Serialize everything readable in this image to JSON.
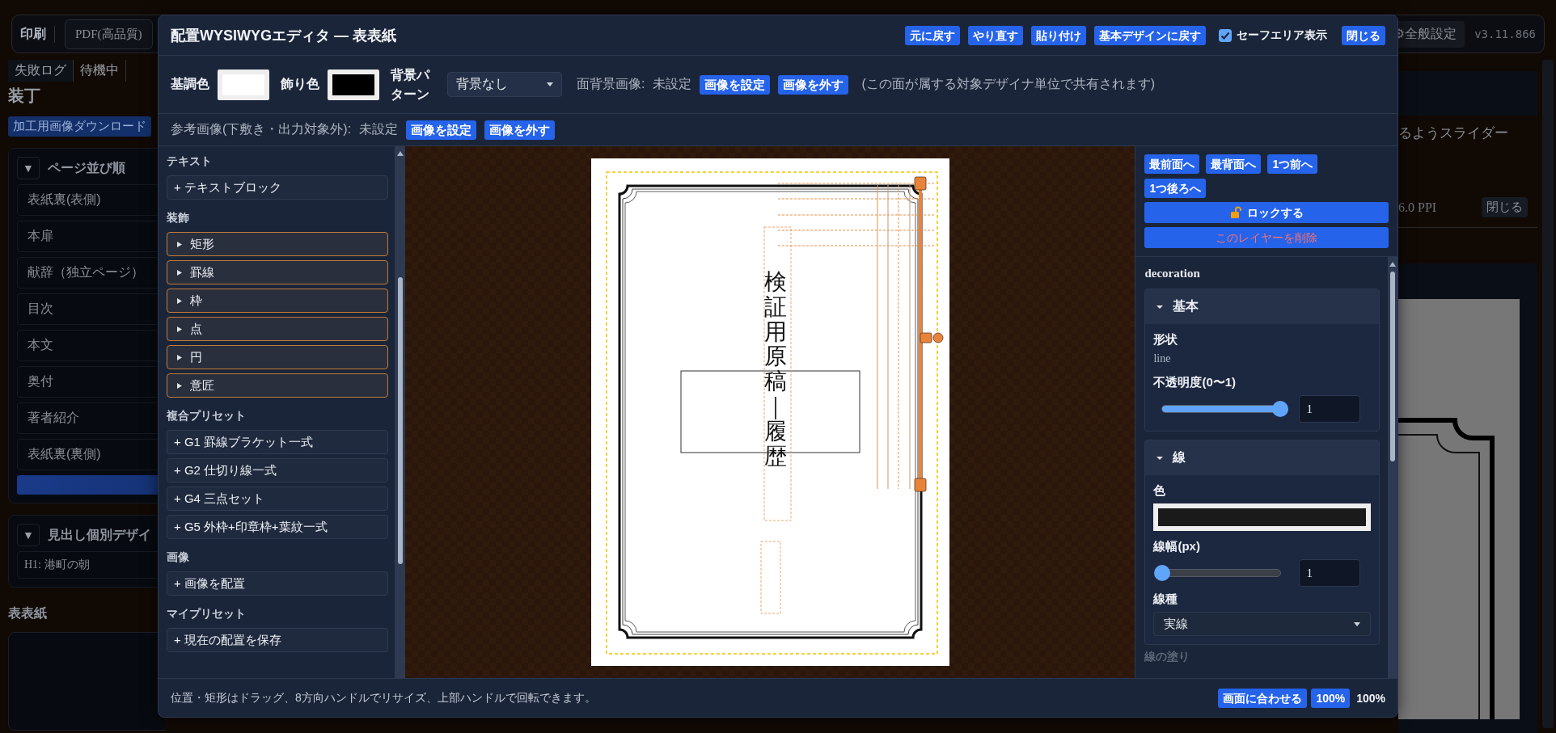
{
  "background_app": {
    "toolbar": {
      "title": "印刷",
      "format": "PDF(高品質)",
      "settings_button": "⚙全般設定",
      "version": "v3.11.866"
    },
    "tabs": [
      {
        "label": "失敗ログ",
        "selected": true
      },
      {
        "label": "待機中",
        "selected": false
      }
    ],
    "heading": "装丁",
    "download_button": "加工用画像ダウンロード",
    "page_order": {
      "toggle": "▼",
      "title": "ページ並び順",
      "items": [
        "表紙裏(表側)",
        "本扉",
        "献辞（独立ページ）",
        "目次",
        "本文",
        "奥付",
        "著者紹介",
        "表紙裏(裏側)"
      ]
    },
    "heading_designs": {
      "toggle": "▼",
      "title": "見出し個別デザイ",
      "items": [
        "H1: 港町の朝"
      ]
    },
    "cover_label": "表表紙",
    "right_panel": {
      "hint": "るようスライダー",
      "resolution": "6.0 PPI",
      "close_button": "閉じる"
    }
  },
  "editor": {
    "title": "配置WYSIWYGエディタ — 表表紙",
    "actions": [
      "元に戻す",
      "やり直す",
      "貼り付け",
      "基本デザインに戻す"
    ],
    "safe_area": {
      "label": "セーフエリア表示",
      "checked": true
    },
    "close_button": "閉じる",
    "base_color": {
      "label": "基調色",
      "color": "#ffffff"
    },
    "accent_color": {
      "label": "飾り色",
      "color": "#000000"
    },
    "background_pattern": {
      "label": "背景パターン",
      "value": "背景なし"
    },
    "face_image": {
      "label": "面背景画像:",
      "status": "未設定",
      "buttons": [
        "画像を設定",
        "画像を外す"
      ],
      "note": "(この面が属する対象デザイナ単位で共有されます)"
    },
    "reference_image": {
      "label": "参考画像(下敷き・出力対象外):",
      "status": "未設定",
      "buttons": [
        "画像を設定",
        "画像を外す"
      ]
    },
    "palette": [
      {
        "heading": "テキスト",
        "items": [
          {
            "kind": "add",
            "label": "+ テキストブロック"
          }
        ]
      },
      {
        "heading": "装飾",
        "items": [
          {
            "kind": "group",
            "label": "矩形"
          },
          {
            "kind": "group",
            "label": "罫線"
          },
          {
            "kind": "group",
            "label": "枠"
          },
          {
            "kind": "group",
            "label": "点"
          },
          {
            "kind": "group",
            "label": "円"
          },
          {
            "kind": "group",
            "label": "意匠"
          }
        ]
      },
      {
        "heading": "複合プリセット",
        "items": [
          {
            "kind": "add",
            "label": "+ G1 罫線ブラケット一式"
          },
          {
            "kind": "add",
            "label": "+ G2 仕切り線一式"
          },
          {
            "kind": "add",
            "label": "+ G4 三点セット"
          },
          {
            "kind": "add",
            "label": "+ G5 外枠+印章枠+葉紋一式"
          }
        ]
      },
      {
        "heading": "画像",
        "items": [
          {
            "kind": "add",
            "label": "+ 画像を配置"
          }
        ]
      },
      {
        "heading": "マイプリセット",
        "items": [
          {
            "kind": "add",
            "label": "+ 現在の配置を保存"
          }
        ]
      }
    ],
    "canvas": {
      "title_text": "検証用原稿｜履歴"
    },
    "layer_actions": [
      "最前面へ",
      "最背面へ",
      "1つ前へ",
      "1つ後ろへ"
    ],
    "lock_button": "ロックする",
    "delete_button": "このレイヤーを削除",
    "properties": {
      "type": "decoration",
      "sections": [
        {
          "title": "基本",
          "expanded": true,
          "fields": [
            {
              "kind": "static",
              "label": "形状",
              "value": "line"
            },
            {
              "kind": "slider",
              "label": "不透明度(0〜1)",
              "level": 1,
              "value": "1"
            }
          ]
        },
        {
          "title": "線",
          "expanded": true,
          "fields": [
            {
              "kind": "color",
              "label": "色",
              "color": "#1a1a1a"
            },
            {
              "kind": "slider",
              "label": "線幅(px)",
              "level": 0,
              "value": "1"
            },
            {
              "kind": "select",
              "label": "線種",
              "value": "実線"
            }
          ]
        }
      ],
      "more_label": "線の塗り"
    },
    "footer": {
      "hint": "位置・矩形はドラッグ、8方向ハンドルでリサイズ、上部ハンドルで回転できます。",
      "fit_button": "画面に合わせる",
      "zoom_button": "100%",
      "zoom": "100%"
    }
  }
}
